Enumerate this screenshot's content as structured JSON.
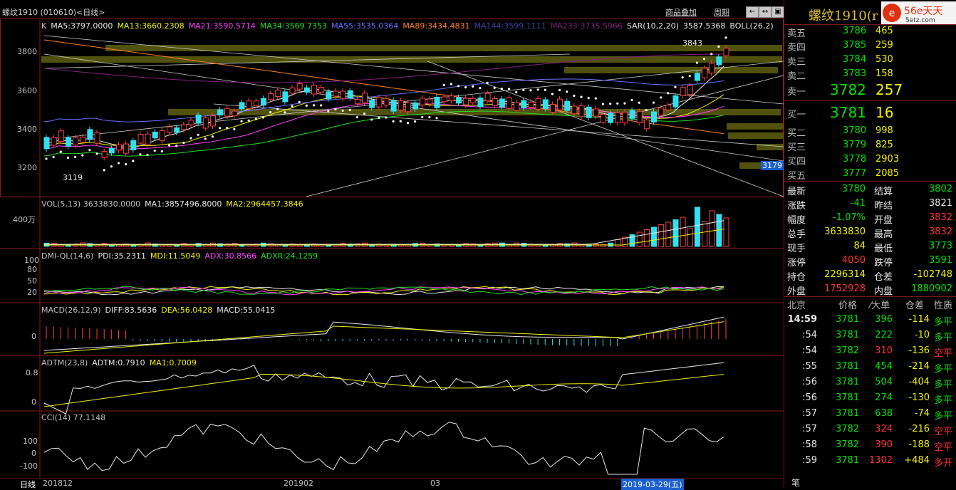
{
  "header": {
    "title": "螺纹1910 (010610)<日线>",
    "links": [
      "商品叠加",
      "周期"
    ],
    "nav_icons": [
      "prev-icon",
      "expand-icon",
      "restore-icon",
      "close-icon"
    ]
  },
  "price_panel": {
    "ma_legend": [
      {
        "text": "K",
        "color": "#c0c0c0"
      },
      {
        "text": "MA5:3797.0000",
        "color": "#e8e8e8"
      },
      {
        "text": "MA13:3660.2308",
        "color": "#f0f000"
      },
      {
        "text": "MA21:3590.5714",
        "color": "#ff40ff"
      },
      {
        "text": "MA34:3569.7353",
        "color": "#20e020"
      },
      {
        "text": "MA55:3535.0364",
        "color": "#6a70ff"
      },
      {
        "text": "MA89:3434.4831",
        "color": "#ff8020"
      },
      {
        "text": "MA144:3599.1111",
        "color": "#4040a0"
      },
      {
        "text": "MA233:3735.5966",
        "color": "#802080"
      },
      {
        "text": "SAR(10,2,20)",
        "color": "#e8e8e8"
      },
      {
        "text": "3587.5368",
        "color": "#e8e8e8"
      },
      {
        "text": "BOLL(26,2)",
        "color": "#e8e8e8"
      }
    ],
    "y_ticks": [
      "3800",
      "3600",
      "3400",
      "3200"
    ],
    "high_label": "3843",
    "low_label": "3119",
    "last_label": "3179"
  },
  "vol_panel": {
    "legend": [
      {
        "text": "VOL(5,13) 3633830.0000",
        "color": "#c0c0c0"
      },
      {
        "text": "MA1:3857496.8000",
        "color": "#e8e8e8"
      },
      {
        "text": "MA2:2964457.3846",
        "color": "#f0f000"
      }
    ],
    "y_tick": "400万"
  },
  "dmi_panel": {
    "legend": [
      {
        "text": "DMI-QL(14,6)",
        "color": "#c0c0c0"
      },
      {
        "text": "PDI:35.2311",
        "color": "#e8e8e8"
      },
      {
        "text": "MDI:11.5049",
        "color": "#f0f000"
      },
      {
        "text": "ADX:30.8566",
        "color": "#ff40ff"
      },
      {
        "text": "ADXR:24.1259",
        "color": "#20e020"
      }
    ],
    "y_ticks": [
      "100",
      "80",
      "50",
      "20"
    ]
  },
  "macd_panel": {
    "legend": [
      {
        "text": "MACD(26,12,9)",
        "color": "#c0c0c0"
      },
      {
        "text": "DIFF:83.5636",
        "color": "#e8e8e8"
      },
      {
        "text": "DEA:56.0428",
        "color": "#f0f000"
      },
      {
        "text": "MACD:55.0415",
        "color": "#e8e8e8"
      }
    ],
    "y_tick": "0"
  },
  "adtm_panel": {
    "legend": [
      {
        "text": "ADTM(23,8)",
        "color": "#c0c0c0"
      },
      {
        "text": "ADTM:0.7910",
        "color": "#e8e8e8"
      },
      {
        "text": "MA1:0.7009",
        "color": "#f0f000"
      }
    ],
    "y_ticks": [
      "0.8",
      "0"
    ]
  },
  "cci_panel": {
    "legend": [
      {
        "text": "CCI(14) 77.1148",
        "color": "#c0c0c0"
      }
    ],
    "y_ticks": [
      "100",
      "0",
      "-100"
    ]
  },
  "x_axis": {
    "period": "日线",
    "labels": [
      "201812",
      "201902",
      "03"
    ],
    "cursor_date": "2019-03-29(五)"
  },
  "quote": {
    "name": "螺纹1910",
    "name_suffix": "(r",
    "logo_text": "56e天天",
    "logo_sub": "5etz.com",
    "asks": [
      {
        "label": "卖五",
        "price": "3786",
        "vol": "465"
      },
      {
        "label": "卖四",
        "price": "3785",
        "vol": "259"
      },
      {
        "label": "卖三",
        "price": "3784",
        "vol": "530"
      },
      {
        "label": "卖二",
        "price": "3783",
        "vol": "158"
      },
      {
        "label": "卖一",
        "price": "3782",
        "vol": "257"
      }
    ],
    "bids": [
      {
        "label": "买一",
        "price": "3781",
        "vol": "16"
      },
      {
        "label": "买二",
        "price": "3780",
        "vol": "998"
      },
      {
        "label": "买三",
        "price": "3779",
        "vol": "825"
      },
      {
        "label": "买四",
        "price": "3778",
        "vol": "2903"
      },
      {
        "label": "买五",
        "price": "3777",
        "vol": "2085"
      }
    ],
    "stats": [
      {
        "l1": "最新",
        "v1": "3780",
        "c1": "green",
        "l2": "结算",
        "v2": "3802",
        "c2": "green"
      },
      {
        "l1": "涨跌",
        "v1": "-41",
        "c1": "green",
        "l2": "昨结",
        "v2": "3821",
        "c2": "white"
      },
      {
        "l1": "幅度",
        "v1": "-1.07%",
        "c1": "green",
        "l2": "开盘",
        "v2": "3832",
        "c2": "red"
      },
      {
        "l1": "总手",
        "v1": "3633830",
        "c1": "yellow",
        "l2": "最高",
        "v2": "3832",
        "c2": "red"
      },
      {
        "l1": "现手",
        "v1": "84",
        "c1": "yellow",
        "l2": "最低",
        "v2": "3773",
        "c2": "green"
      },
      {
        "l1": "涨停",
        "v1": "4050",
        "c1": "red",
        "l2": "跌停",
        "v2": "3591",
        "c2": "green"
      },
      {
        "l1": "持仓",
        "v1": "2296314",
        "c1": "yellow",
        "l2": "仓差",
        "v2": "-102748",
        "c2": "yellow"
      },
      {
        "l1": "外盘",
        "v1": "1752928",
        "c1": "red",
        "l2": "内盘",
        "v2": "1880902",
        "c2": "green"
      }
    ],
    "ticks_header": [
      "北京",
      "价格",
      "⁄大单",
      "仓差",
      "性质"
    ],
    "ticks": [
      {
        "time": "14:59",
        "price": "3781",
        "pc": "green",
        "vol": "396",
        "vc": "green",
        "diff": "-114",
        "type": "多平",
        "tc": "green"
      },
      {
        "time": ":54",
        "price": "3781",
        "pc": "green",
        "vol": "222",
        "vc": "green",
        "diff": "-10",
        "type": "多平",
        "tc": "green"
      },
      {
        "time": ":54",
        "price": "3782",
        "pc": "green",
        "vol": "310",
        "vc": "red",
        "diff": "-136",
        "type": "空平",
        "tc": "red"
      },
      {
        "time": ":55",
        "price": "3781",
        "pc": "green",
        "vol": "454",
        "vc": "green",
        "diff": "-214",
        "type": "多平",
        "tc": "green"
      },
      {
        "time": ":56",
        "price": "3781",
        "pc": "green",
        "vol": "504",
        "vc": "green",
        "diff": "-404",
        "type": "多平",
        "tc": "green"
      },
      {
        "time": ":56",
        "price": "3781",
        "pc": "green",
        "vol": "274",
        "vc": "green",
        "diff": "-130",
        "type": "多平",
        "tc": "green"
      },
      {
        "time": ":57",
        "price": "3781",
        "pc": "green",
        "vol": "638",
        "vc": "green",
        "diff": "-74",
        "type": "多平",
        "tc": "green"
      },
      {
        "time": ":57",
        "price": "3782",
        "pc": "green",
        "vol": "324",
        "vc": "red",
        "diff": "-216",
        "type": "空平",
        "tc": "red"
      },
      {
        "time": ":58",
        "price": "3782",
        "pc": "green",
        "vol": "390",
        "vc": "red",
        "diff": "-188",
        "type": "空平",
        "tc": "red"
      },
      {
        "time": ":59",
        "price": "3781",
        "pc": "green",
        "vol": "1302",
        "vc": "red",
        "diff": "+484",
        "type": "多开",
        "tc": "red"
      }
    ],
    "bottom_tab": "笔"
  }
}
